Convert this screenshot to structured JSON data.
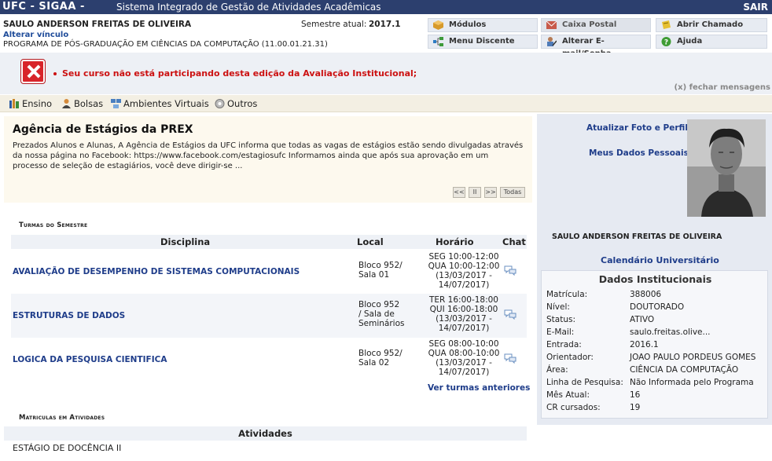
{
  "topbar": {
    "brand": "UFC - SIGAA -",
    "system": "Sistema Integrado de Gestão de Atividades Acadêmicas",
    "exit": "SAIR"
  },
  "user": {
    "name": "SAULO ANDERSON FREITAS DE OLIVEIRA",
    "semester_label": "Semestre atual:",
    "semester": "2017.1",
    "change_link": "Alterar vínculo",
    "program": "PROGRAMA DE PÓS-GRADUAÇÃO EM CIÊNCIAS DA COMPUTAÇÃO (11.00.01.21.31)"
  },
  "menu": {
    "modulos": "Módulos",
    "caixa": "Caixa Postal",
    "chamado": "Abrir Chamado",
    "discente": "Menu Discente",
    "email": "Alterar E-mail/Senha",
    "ajuda": "Ajuda"
  },
  "messages": {
    "error": "Seu curso não está participando desta edição da Avaliação Institucional;",
    "close": "(x) fechar mensagens"
  },
  "tabs": [
    "Ensino",
    "Bolsas",
    "Ambientes Virtuais",
    "Outros"
  ],
  "notice": {
    "title": "Agência de Estágios da PREX",
    "text": "Prezados Alunos e Alunas, A Agência de Estágios da UFC informa que todas as vagas de estágios estão sendo divulgadas através da nossa página no Facebook: https://www.facebook.com/estagiosufc Informamos ainda que após sua aprovação em um processo de seleção de estagiários, você deve dirigir-se ...",
    "pager": {
      "prev": "<<",
      "pause": "II",
      "next": ">>",
      "all": "Todas"
    }
  },
  "turmas": {
    "title": "Turmas do Semestre",
    "headers": {
      "disciplina": "Disciplina",
      "local": "Local",
      "horario": "Horário",
      "chat": "Chat"
    },
    "rows": [
      {
        "disciplina": "AVALIAÇÃO DE DESEMPENHO DE SISTEMAS COMPUTACIONAIS",
        "local": [
          "Bloco 952/",
          "Sala 01"
        ],
        "horario": [
          "SEG 10:00-12:00",
          "QUA 10:00-12:00",
          "(13/03/2017 -",
          "14/07/2017)"
        ]
      },
      {
        "disciplina": "ESTRUTURAS DE DADOS",
        "local": [
          "Bloco 952",
          "/ Sala de",
          "Seminários"
        ],
        "horario": [
          "TER 16:00-18:00",
          "QUI 16:00-18:00",
          "(13/03/2017 -",
          "14/07/2017)"
        ]
      },
      {
        "disciplina": "LOGICA DA PESQUISA CIENTIFICA",
        "local": [
          "Bloco 952/",
          "Sala 02"
        ],
        "horario": [
          "SEG 08:00-10:00",
          "QUA 08:00-10:00",
          "(13/03/2017 -",
          "14/07/2017)"
        ]
      }
    ],
    "see_old": "Ver turmas anteriores"
  },
  "atividades": {
    "title": "Matriculas em Atividades",
    "header": "Atividades",
    "rows": [
      "ESTÁGIO DE DOCÊNCIA II"
    ]
  },
  "profile": {
    "update_photo": "Atualizar Foto e Perfil",
    "my_data": "Meus Dados Pessoais",
    "name": "SAULO ANDERSON FREITAS DE OLIVEIRA",
    "calendar": "Calendário Universitário"
  },
  "dados": {
    "title": "Dados Institucionais",
    "fields": [
      {
        "k": "Matrícula:",
        "v": "388006"
      },
      {
        "k": "Nível:",
        "v": "DOUTORADO"
      },
      {
        "k": "Status:",
        "v": "ATIVO"
      },
      {
        "k": "E-Mail:",
        "v": "saulo.freitas.olive..."
      },
      {
        "k": "Entrada:",
        "v": "2016.1"
      },
      {
        "k": "Orientador:",
        "v": "JOAO PAULO PORDEUS GOMES"
      },
      {
        "k": "Área:",
        "v": "CIÊNCIA DA COMPUTAÇÃO"
      },
      {
        "k": "Linha de Pesquisa:",
        "v": "Não Informada pelo Programa"
      },
      {
        "k": "Mês Atual:",
        "v": "16"
      },
      {
        "k": "CR cursados:",
        "v": "19"
      }
    ]
  },
  "colors": {
    "topbar": "#2c3f6e",
    "link": "#1f3d8a",
    "error": "#cc1111"
  }
}
